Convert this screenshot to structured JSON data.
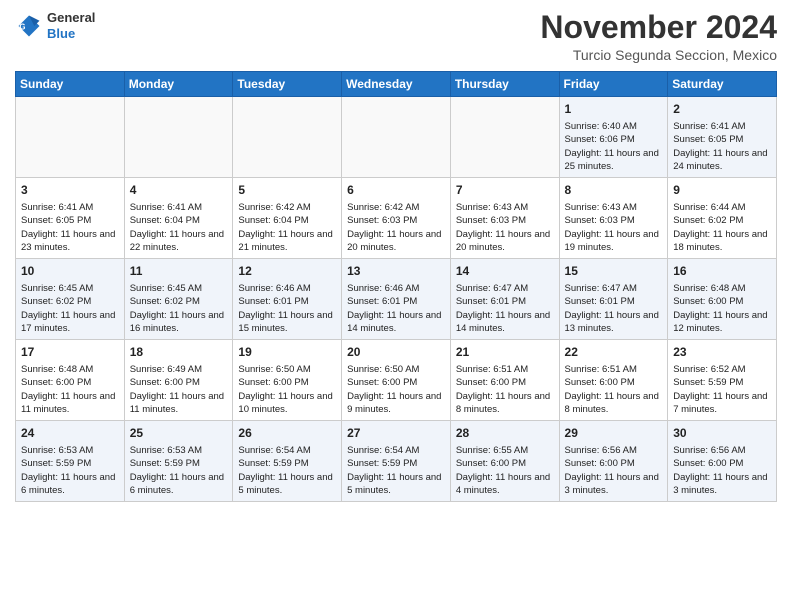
{
  "logo": {
    "general": "General",
    "blue": "Blue"
  },
  "title": "November 2024",
  "location": "Turcio Segunda Seccion, Mexico",
  "days_header": [
    "Sunday",
    "Monday",
    "Tuesday",
    "Wednesday",
    "Thursday",
    "Friday",
    "Saturday"
  ],
  "weeks": [
    [
      {
        "day": "",
        "info": ""
      },
      {
        "day": "",
        "info": ""
      },
      {
        "day": "",
        "info": ""
      },
      {
        "day": "",
        "info": ""
      },
      {
        "day": "",
        "info": ""
      },
      {
        "day": "1",
        "info": "Sunrise: 6:40 AM\nSunset: 6:06 PM\nDaylight: 11 hours and 25 minutes."
      },
      {
        "day": "2",
        "info": "Sunrise: 6:41 AM\nSunset: 6:05 PM\nDaylight: 11 hours and 24 minutes."
      }
    ],
    [
      {
        "day": "3",
        "info": "Sunrise: 6:41 AM\nSunset: 6:05 PM\nDaylight: 11 hours and 23 minutes."
      },
      {
        "day": "4",
        "info": "Sunrise: 6:41 AM\nSunset: 6:04 PM\nDaylight: 11 hours and 22 minutes."
      },
      {
        "day": "5",
        "info": "Sunrise: 6:42 AM\nSunset: 6:04 PM\nDaylight: 11 hours and 21 minutes."
      },
      {
        "day": "6",
        "info": "Sunrise: 6:42 AM\nSunset: 6:03 PM\nDaylight: 11 hours and 20 minutes."
      },
      {
        "day": "7",
        "info": "Sunrise: 6:43 AM\nSunset: 6:03 PM\nDaylight: 11 hours and 20 minutes."
      },
      {
        "day": "8",
        "info": "Sunrise: 6:43 AM\nSunset: 6:03 PM\nDaylight: 11 hours and 19 minutes."
      },
      {
        "day": "9",
        "info": "Sunrise: 6:44 AM\nSunset: 6:02 PM\nDaylight: 11 hours and 18 minutes."
      }
    ],
    [
      {
        "day": "10",
        "info": "Sunrise: 6:45 AM\nSunset: 6:02 PM\nDaylight: 11 hours and 17 minutes."
      },
      {
        "day": "11",
        "info": "Sunrise: 6:45 AM\nSunset: 6:02 PM\nDaylight: 11 hours and 16 minutes."
      },
      {
        "day": "12",
        "info": "Sunrise: 6:46 AM\nSunset: 6:01 PM\nDaylight: 11 hours and 15 minutes."
      },
      {
        "day": "13",
        "info": "Sunrise: 6:46 AM\nSunset: 6:01 PM\nDaylight: 11 hours and 14 minutes."
      },
      {
        "day": "14",
        "info": "Sunrise: 6:47 AM\nSunset: 6:01 PM\nDaylight: 11 hours and 14 minutes."
      },
      {
        "day": "15",
        "info": "Sunrise: 6:47 AM\nSunset: 6:01 PM\nDaylight: 11 hours and 13 minutes."
      },
      {
        "day": "16",
        "info": "Sunrise: 6:48 AM\nSunset: 6:00 PM\nDaylight: 11 hours and 12 minutes."
      }
    ],
    [
      {
        "day": "17",
        "info": "Sunrise: 6:48 AM\nSunset: 6:00 PM\nDaylight: 11 hours and 11 minutes."
      },
      {
        "day": "18",
        "info": "Sunrise: 6:49 AM\nSunset: 6:00 PM\nDaylight: 11 hours and 11 minutes."
      },
      {
        "day": "19",
        "info": "Sunrise: 6:50 AM\nSunset: 6:00 PM\nDaylight: 11 hours and 10 minutes."
      },
      {
        "day": "20",
        "info": "Sunrise: 6:50 AM\nSunset: 6:00 PM\nDaylight: 11 hours and 9 minutes."
      },
      {
        "day": "21",
        "info": "Sunrise: 6:51 AM\nSunset: 6:00 PM\nDaylight: 11 hours and 8 minutes."
      },
      {
        "day": "22",
        "info": "Sunrise: 6:51 AM\nSunset: 6:00 PM\nDaylight: 11 hours and 8 minutes."
      },
      {
        "day": "23",
        "info": "Sunrise: 6:52 AM\nSunset: 5:59 PM\nDaylight: 11 hours and 7 minutes."
      }
    ],
    [
      {
        "day": "24",
        "info": "Sunrise: 6:53 AM\nSunset: 5:59 PM\nDaylight: 11 hours and 6 minutes."
      },
      {
        "day": "25",
        "info": "Sunrise: 6:53 AM\nSunset: 5:59 PM\nDaylight: 11 hours and 6 minutes."
      },
      {
        "day": "26",
        "info": "Sunrise: 6:54 AM\nSunset: 5:59 PM\nDaylight: 11 hours and 5 minutes."
      },
      {
        "day": "27",
        "info": "Sunrise: 6:54 AM\nSunset: 5:59 PM\nDaylight: 11 hours and 5 minutes."
      },
      {
        "day": "28",
        "info": "Sunrise: 6:55 AM\nSunset: 6:00 PM\nDaylight: 11 hours and 4 minutes."
      },
      {
        "day": "29",
        "info": "Sunrise: 6:56 AM\nSunset: 6:00 PM\nDaylight: 11 hours and 3 minutes."
      },
      {
        "day": "30",
        "info": "Sunrise: 6:56 AM\nSunset: 6:00 PM\nDaylight: 11 hours and 3 minutes."
      }
    ]
  ]
}
